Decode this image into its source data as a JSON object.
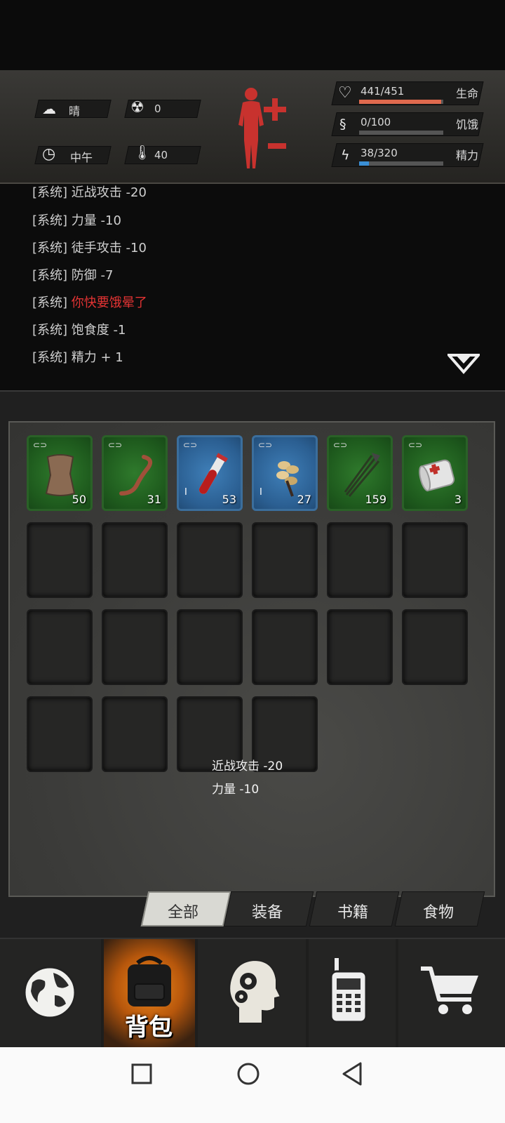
{
  "status": {
    "weather": {
      "icon": "cloud-sun-icon",
      "label": "晴"
    },
    "radiation": {
      "icon": "radiation-icon",
      "value": "0"
    },
    "time": {
      "icon": "clock-icon",
      "label": "中午"
    },
    "temperature": {
      "icon": "thermometer-icon",
      "value": "40"
    },
    "body": {
      "icon": "body-figure-icon",
      "plus": "+",
      "minus": "−"
    },
    "health": {
      "icon": "heart-icon",
      "text": "441/451",
      "label": "生命",
      "fraction": 0.978,
      "color": "#e06a4e"
    },
    "hunger": {
      "icon": "stomach-icon",
      "text": "0/100",
      "label": "饥饿",
      "fraction": 0.0,
      "color": "#c9a24a"
    },
    "energy": {
      "icon": "energy-icon",
      "text": "38/320",
      "label": "精力",
      "fraction": 0.119,
      "color": "#3a8fd6"
    }
  },
  "log": {
    "lines": [
      {
        "prefix": "[系统]",
        "text": "近战攻击 -20"
      },
      {
        "prefix": "[系统]",
        "text": "力量 -10"
      },
      {
        "prefix": "[系统]",
        "text": "徒手攻击 -10"
      },
      {
        "prefix": "[系统]",
        "text": "防御 -7"
      },
      {
        "prefix": "[系统]",
        "text": "你快要饿晕了",
        "warning": true
      },
      {
        "prefix": "[系统]",
        "text": "饱食度 -1"
      },
      {
        "prefix": "[系统]",
        "text": "精力 + 1"
      }
    ],
    "collapse_icon": "chevron-down-icon"
  },
  "inventory": {
    "items": [
      {
        "name": "leather",
        "count": "50",
        "rarity": "green"
      },
      {
        "name": "worm",
        "count": "31",
        "rarity": "green"
      },
      {
        "name": "blood-vial",
        "count": "53",
        "rarity": "blue"
      },
      {
        "name": "seeds",
        "count": "27",
        "rarity": "blue"
      },
      {
        "name": "arrows",
        "count": "159",
        "rarity": "green"
      },
      {
        "name": "bandage",
        "count": "3",
        "rarity": "green"
      }
    ],
    "tooltip": [
      "近战攻击 -20",
      "力量 -10"
    ]
  },
  "tabs": [
    {
      "label": "全部",
      "active": true
    },
    {
      "label": "装备",
      "active": false
    },
    {
      "label": "书籍",
      "active": false
    },
    {
      "label": "食物",
      "active": false
    }
  ],
  "nav": [
    {
      "icon": "globe-icon",
      "label": ""
    },
    {
      "icon": "backpack-icon",
      "label": "背包",
      "active": true
    },
    {
      "icon": "head-gears-icon",
      "label": ""
    },
    {
      "icon": "walkie-talkie-icon",
      "label": ""
    },
    {
      "icon": "cart-icon",
      "label": ""
    }
  ]
}
